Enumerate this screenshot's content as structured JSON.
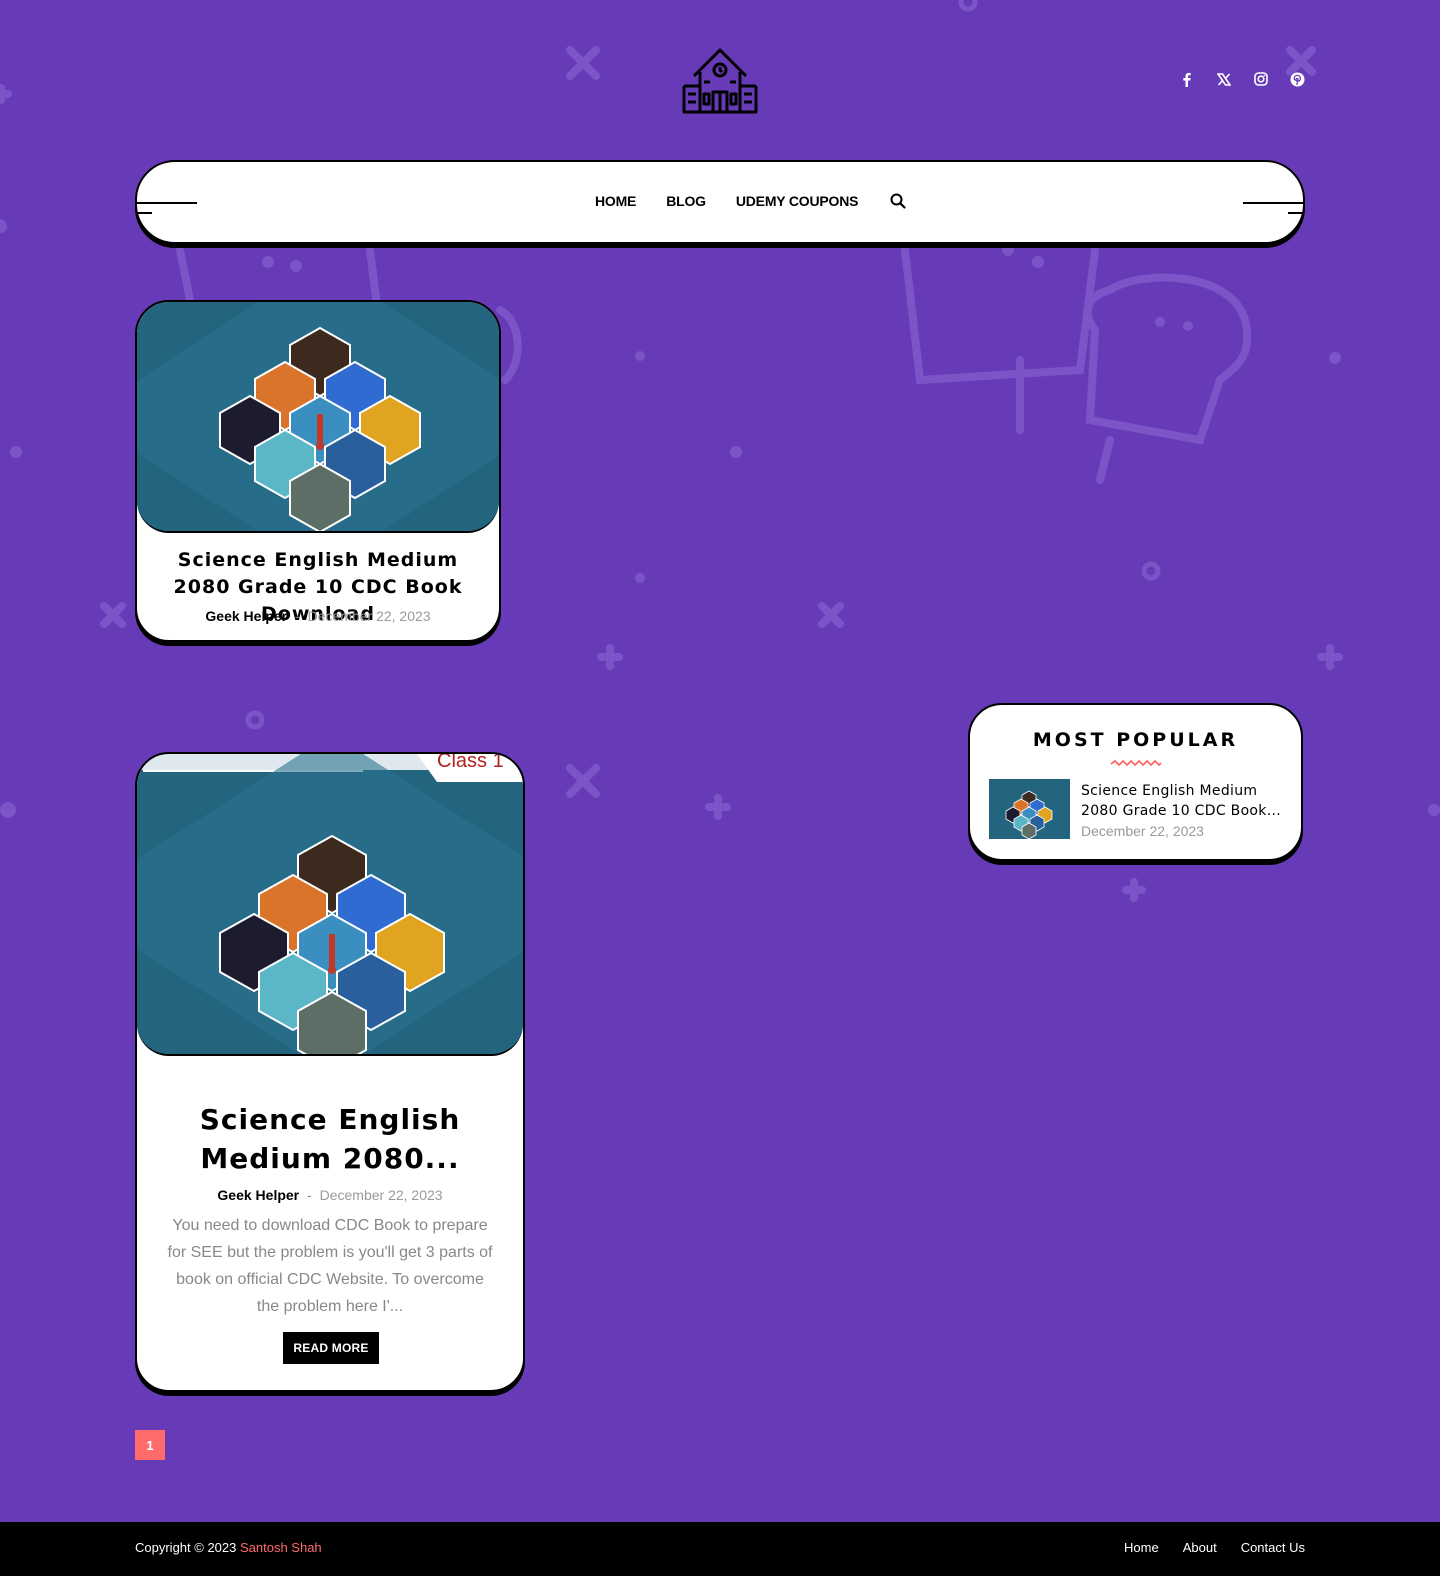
{
  "header": {
    "social": [
      {
        "icon": "facebook-icon"
      },
      {
        "icon": "x-twitter-icon"
      },
      {
        "icon": "instagram-icon"
      },
      {
        "icon": "pinterest-icon"
      }
    ]
  },
  "nav": {
    "items": [
      "HOME",
      "BLOG",
      "UDEMY COUPONS"
    ]
  },
  "posts": [
    {
      "title": "Science English Medium 2080 Grade 10 CDC Book Download",
      "author": "Geek Helper",
      "separator": "-",
      "date": "December 22, 2023"
    },
    {
      "title": "Science English Medium 2080...",
      "author": "Geek Helper",
      "separator": "-",
      "date": "December 22, 2023",
      "excerpt": "You need to download CDC Book to prepare for SEE but the problem is you'll get 3 parts of book on official CDC Website. To overcome the problem here I'...",
      "thumb_caption": "Class 1",
      "read_more": "READ MORE"
    }
  ],
  "sidebar": {
    "widget_title": "MOST POPULAR",
    "popular": [
      {
        "title_line1": "Science English Medium",
        "title_line2": "2080 Grade 10 CDC Book...",
        "date": "December 22, 2023"
      }
    ]
  },
  "pagination": {
    "current": "1"
  },
  "footer": {
    "copyright": "Copyright © 2023",
    "owner": "Santosh Shah",
    "links": [
      "Home",
      "About",
      "Contact Us"
    ]
  },
  "colors": {
    "background": "#673ab7",
    "accent": "#ff6b6b",
    "card": "#ffffff",
    "footer": "#000000"
  }
}
